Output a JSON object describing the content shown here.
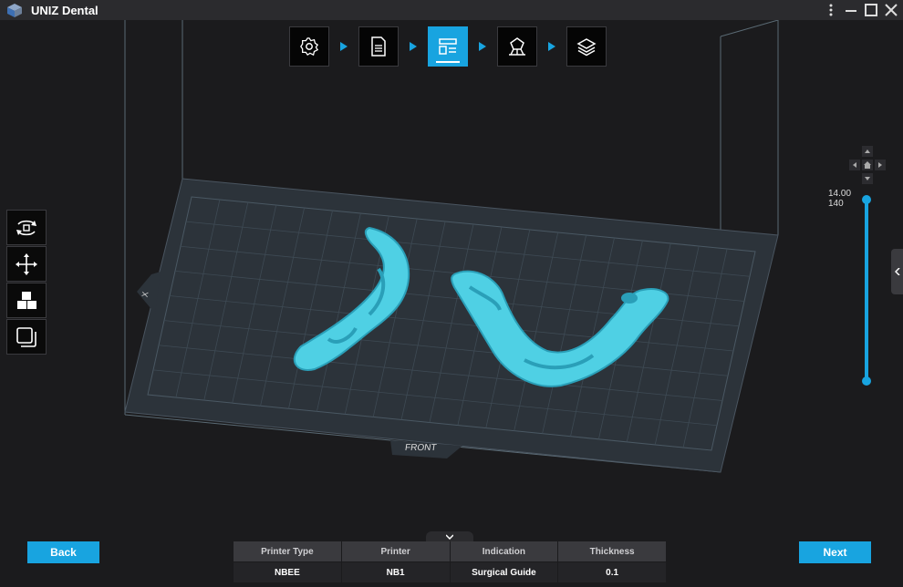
{
  "titlebar": {
    "app_title": "UNIZ Dental"
  },
  "workflow_steps": [
    {
      "id": "settings",
      "icon": "gear-icon"
    },
    {
      "id": "file",
      "icon": "document-icon"
    },
    {
      "id": "layout",
      "icon": "layout-icon",
      "active": true
    },
    {
      "id": "support",
      "icon": "support-icon"
    },
    {
      "id": "slice",
      "icon": "layers-icon"
    }
  ],
  "left_tools": [
    "rotate-icon",
    "move-icon",
    "arrange-icon",
    "copy-icon"
  ],
  "viewport": {
    "front_label": "FRONT",
    "axis_label": "X"
  },
  "slider": {
    "top_value": "14.00",
    "second_value": "140"
  },
  "buttons": {
    "back": "Back",
    "next": "Next"
  },
  "info_table": {
    "headers": [
      "Printer Type",
      "Printer",
      "Indication",
      "Thickness"
    ],
    "values": [
      "NBEE",
      "NB1",
      "Surgical Guide",
      "0.1"
    ]
  },
  "colors": {
    "accent": "#18a4e0",
    "model": "#4fd0e4",
    "background": "#1b1b1d"
  }
}
